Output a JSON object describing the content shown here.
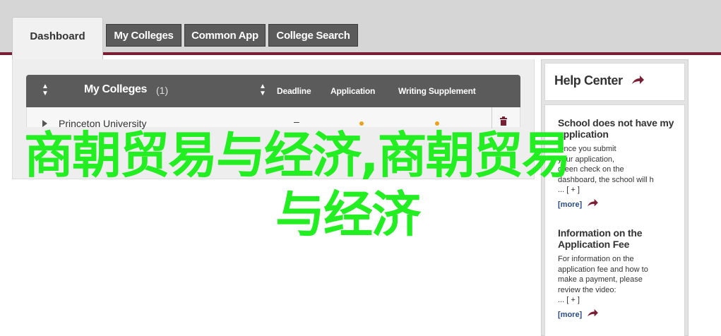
{
  "nav": {
    "tabs": [
      {
        "label": "Dashboard"
      },
      {
        "label": "My Colleges"
      },
      {
        "label": "Common App"
      },
      {
        "label": "College Search"
      }
    ]
  },
  "colleges": {
    "title": "My Colleges",
    "count": "(1)",
    "columns": {
      "deadline": "Deadline",
      "application": "Application",
      "writing": "Writing Supplement"
    },
    "rows": [
      {
        "name": "Princeton University",
        "deadline": "–"
      }
    ]
  },
  "help": {
    "title": "Help Center",
    "articles": [
      {
        "title": "School does not have my application",
        "lines": [
          "Once you submit",
          "your application,",
          "green check on the",
          "dashboard, the school will h",
          "... [ + ]"
        ],
        "more": "[more]"
      },
      {
        "title": "Information on the Application Fee",
        "lines": [
          "For information on the",
          "application fee and how to",
          "make a payment, please",
          "review the video:",
          "... [ + ]"
        ],
        "more": "[more]"
      }
    ]
  },
  "overlay": {
    "line1": "商朝贸易与经济,商朝贸易",
    "line2": "与经济"
  },
  "colors": {
    "accent": "#7a1f33",
    "tab_bg": "#5b5b5b",
    "overlay_text": "#22ee22",
    "status_dot": "#f0a020",
    "link": "#2a4a8a"
  }
}
